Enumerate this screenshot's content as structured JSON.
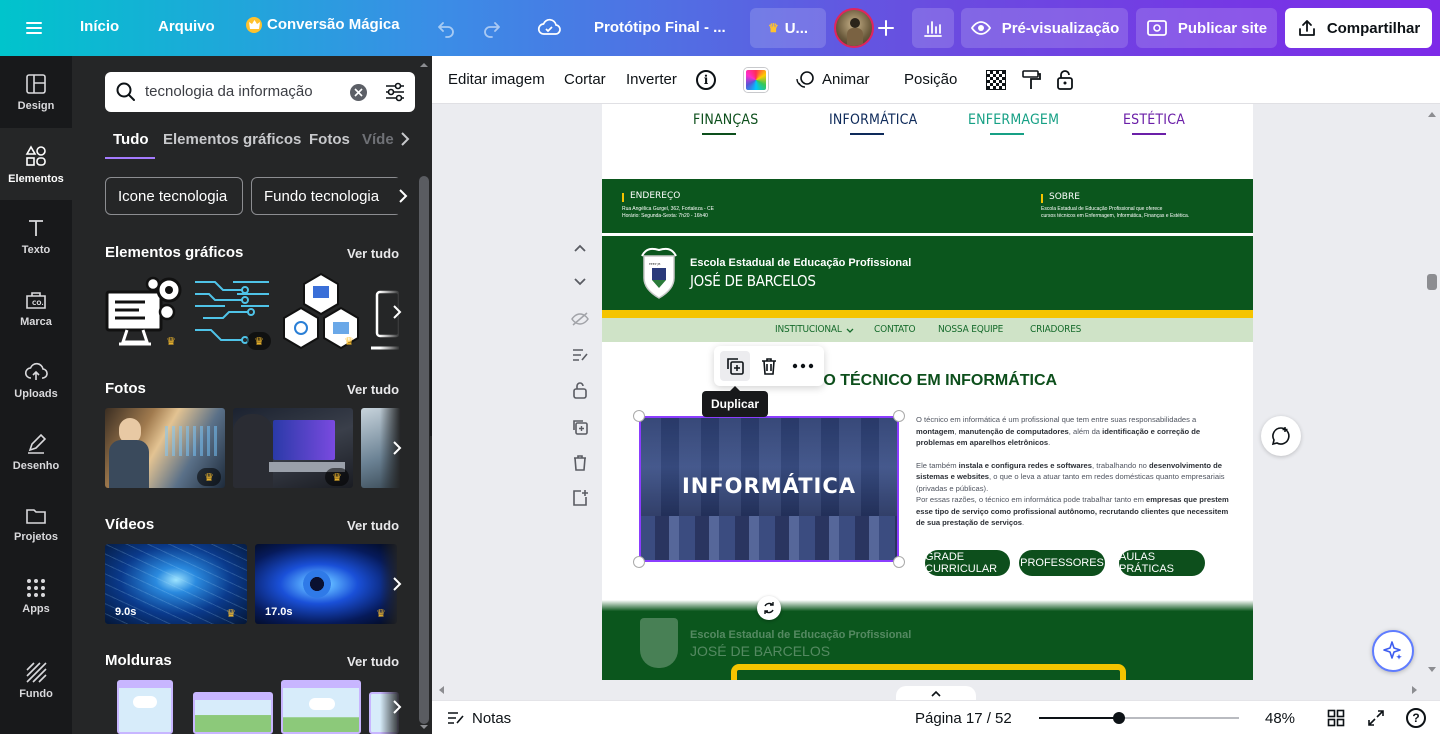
{
  "topbar": {
    "home": "Início",
    "file": "Arquivo",
    "magic": "Conversão Mágica",
    "doc_title": "Protótipo Final - ...",
    "upgrade_short": "U...",
    "preview": "Pré-visualização",
    "publish": "Publicar site",
    "share": "Compartilhar"
  },
  "rail": {
    "items": [
      {
        "label": "Design"
      },
      {
        "label": "Elementos"
      },
      {
        "label": "Texto"
      },
      {
        "label": "Marca"
      },
      {
        "label": "Uploads"
      },
      {
        "label": "Desenho"
      },
      {
        "label": "Projetos"
      },
      {
        "label": "Apps"
      },
      {
        "label": "Fundo"
      }
    ]
  },
  "panel": {
    "search_value": "tecnologia da informação",
    "tabs": [
      "Tudo",
      "Elementos gráficos",
      "Fotos",
      "Víde"
    ],
    "chips": [
      "Icone tecnologia",
      "Fundo tecnologia"
    ],
    "sections": {
      "graphics": "Elementos gráficos",
      "photos": "Fotos",
      "videos": "Vídeos",
      "frames": "Molduras"
    },
    "see_all": "Ver tudo",
    "video_durations": [
      "9.0s",
      "17.0s"
    ]
  },
  "context_toolbar": {
    "edit_image": "Editar imagem",
    "crop": "Cortar",
    "flip": "Inverter",
    "animate": "Animar",
    "position": "Posição"
  },
  "page_content": {
    "courses": [
      "FINANÇAS",
      "INFORMÁTICA",
      "ENFERMAGEM",
      "ESTÉTICA"
    ],
    "address_title": "ENDEREÇO",
    "address_line1": "Rua Angélica Gurgel, 362, Fortaleza - CE",
    "address_line2": "Horário: Segunda-Sexta: 7h20 - 16h40",
    "about_title": "SOBRE",
    "about_line1": "Escola Estadual de Educação Profissional que oferece",
    "about_line2": "cursos técnicos em Enfermagem, Informática, Finanças e Estética.",
    "school_line1": "Escola Estadual de Educação Profissional",
    "school_line2": "JOSÉ DE BARCELOS",
    "nav": [
      "INSTITUCIONAL",
      "CONTATO",
      "NOSSA EQUIPE",
      "CRIADORES"
    ],
    "heading": "CURSO TÉCNICO EM INFORMÁTICA",
    "image_label": "INFORMÁTICA",
    "para1_a": "O técnico em informática é um profissional que tem entre suas responsabilidades a ",
    "para1_b": "montagem",
    "para1_c": ", ",
    "para1_d": "manutenção de computadores",
    "para1_e": ", além da ",
    "para1_f": "identificação e correção de problemas em aparelhos eletrônicos",
    "para1_g": ".",
    "para2_a": "Ele também ",
    "para2_b": "instala e configura redes e softwares",
    "para2_c": ", trabalhando no ",
    "para2_d": "desenvolvimento de sistemas e websites",
    "para2_e": ", o que o leva a atuar tanto em redes domésticas quanto empresariais (privadas e públicas).",
    "para3_a": "Por essas razões, o técnico em informática pode trabalhar tanto em ",
    "para3_b": "empresas que prestem esse tipo de serviço como profissional autônomo, recrutando clientes que necessitem de sua prestação de serviços",
    "para3_c": ".",
    "pills": [
      "GRADE CURRICULAR",
      "PROFESSORES",
      "AULAS PRÁTICAS"
    ],
    "ghost_school": "Escola Estadual de Educação Profissional",
    "ghost_name": "JOSÉ DE BARCELOS"
  },
  "selection_menu": {
    "tooltip": "Duplicar"
  },
  "bottombar": {
    "notes": "Notas",
    "page_indicator": "Página 17 / 52",
    "zoom": "48%",
    "zoom_fraction": 0.48
  },
  "colors": {
    "school_green": "#0d5a1e",
    "selection_purple": "#8b3dff"
  }
}
